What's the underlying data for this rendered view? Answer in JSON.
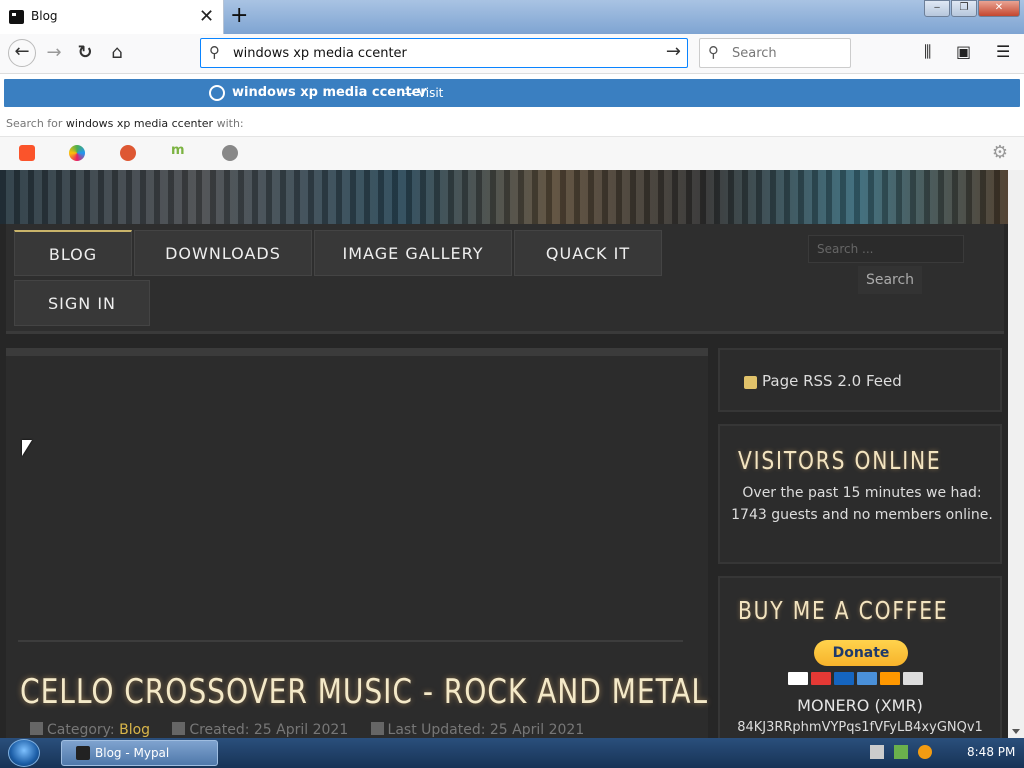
{
  "browser": {
    "tab_title": "Blog",
    "tab_close": "✕",
    "new_tab": "+",
    "url_text": "windows xp media ccenter",
    "search_placeholder": "Search"
  },
  "autocomplete": {
    "query": "windows xp media ccenter",
    "visit_label": "— Visit",
    "search_for_prefix": "Search for",
    "search_for_query": "windows xp media ccenter",
    "search_for_suffix": "with:",
    "engines": [
      "brave-icon",
      "qwant-icon",
      "duckduckgo-icon",
      "mojeek-icon",
      "search-icon"
    ]
  },
  "site": {
    "menu": [
      "BLOG",
      "DOWNLOADS",
      "IMAGE GALLERY",
      "QUACK IT",
      "SIGN IN"
    ],
    "search_placeholder": "Search ...",
    "search_button": "Search"
  },
  "article": {
    "title": "CELLO CROSSOVER MUSIC - ROCK AND METAL",
    "category_label": "Category:",
    "category_value": "Blog",
    "created": "Created: 25 April 2021",
    "updated": "Last Updated: 25 April 2021"
  },
  "sidebar": {
    "rss": "Page RSS 2.0 Feed",
    "visitors_title": "VISITORS ONLINE",
    "visitors_text": "Over the past 15 minutes we had: 1743 guests and no members online.",
    "coffee_title": "BUY ME A COFFEE",
    "donate": "Donate",
    "currency": "MONERO (XMR)",
    "address": "84KJ3RRphmVYPqs1fVFyLB4xyGNQv1"
  },
  "taskbar": {
    "item": "Blog - Mypal",
    "time": "8:48 PM"
  },
  "colors": {
    "accent": "#3a7fc1",
    "gold": "#d9b64a"
  }
}
